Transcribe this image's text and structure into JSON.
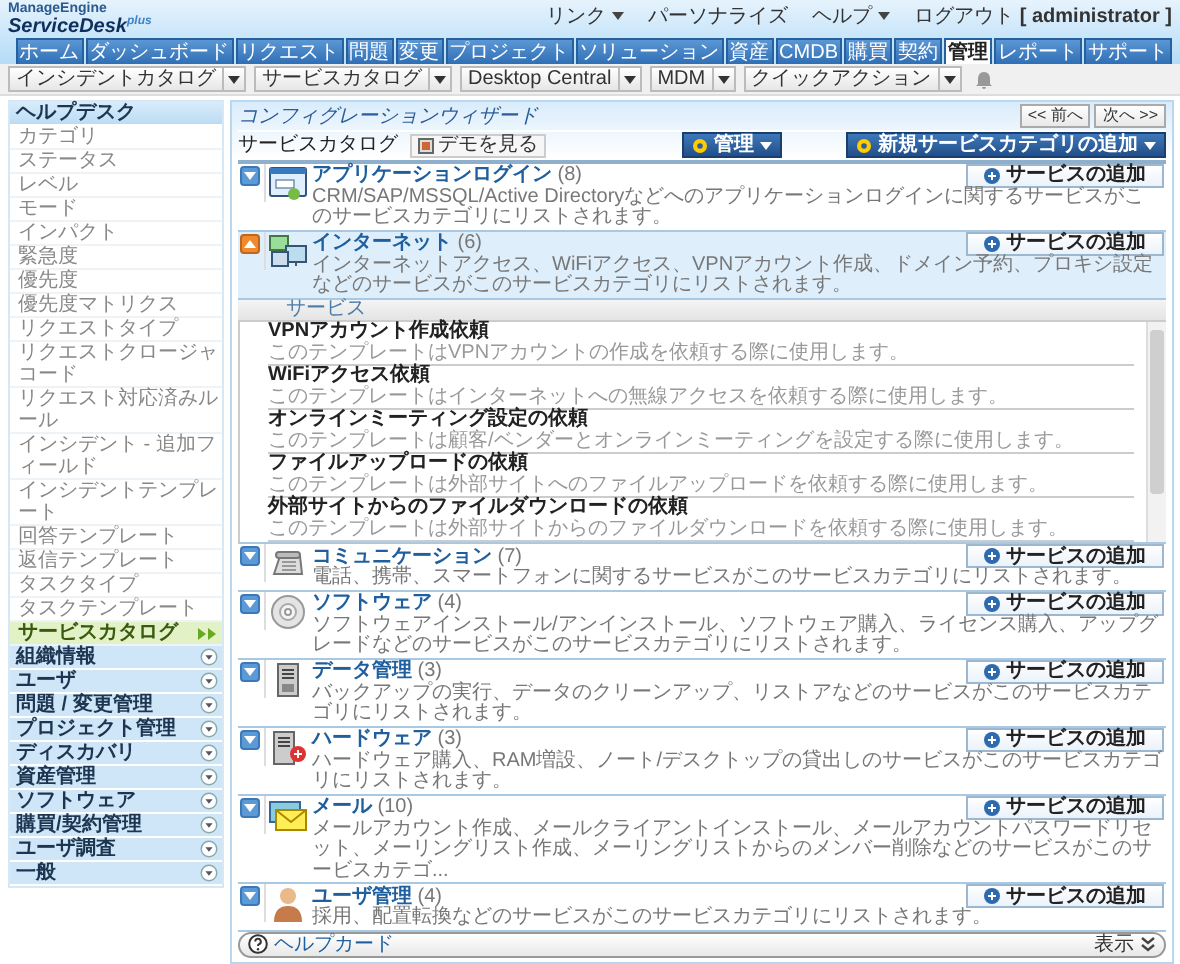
{
  "logo": {
    "brand": "ManageEngine",
    "product": "ServiceDesk",
    "edition": "plus"
  },
  "top_links": [
    {
      "label": "リンク",
      "has_menu": true
    },
    {
      "label": "パーソナライズ",
      "has_menu": false
    },
    {
      "label": "ヘルプ",
      "has_menu": true
    },
    {
      "label": "ログアウト **[ administrator ]**",
      "has_menu": false
    }
  ],
  "tabs": [
    {
      "label": "ホーム",
      "selected": false
    },
    {
      "label": "ダッシュボード",
      "selected": false
    },
    {
      "label": "リクエスト",
      "selected": false
    },
    {
      "label": "問題",
      "selected": false
    },
    {
      "label": "変更",
      "selected": false
    },
    {
      "label": "プロジェクト",
      "selected": false
    },
    {
      "label": "ソリューション",
      "selected": false
    },
    {
      "label": "資産",
      "selected": false
    },
    {
      "label": "CMDB",
      "selected": false
    },
    {
      "label": "購買",
      "selected": false
    },
    {
      "label": "契約",
      "selected": false
    },
    {
      "label": "管理",
      "selected": true
    },
    {
      "label": "レポート",
      "selected": false
    },
    {
      "label": "サポート",
      "selected": false
    }
  ],
  "toolbar": [
    "インシデントカタログ",
    "サービスカタログ",
    "Desktop Central",
    "MDM",
    "クイックアクション"
  ],
  "sidebar": {
    "sections": [
      {
        "label": "ヘルプデスク",
        "expanded": true,
        "children": [
          {
            "label": "カテゴリ",
            "selected": false
          },
          {
            "label": "ステータス",
            "selected": false
          },
          {
            "label": "レベル",
            "selected": false
          },
          {
            "label": "モード",
            "selected": false
          },
          {
            "label": "インパクト",
            "selected": false
          },
          {
            "label": "緊急度",
            "selected": false
          },
          {
            "label": "優先度",
            "selected": false
          },
          {
            "label": "優先度マトリクス",
            "selected": false
          },
          {
            "label": "リクエストタイプ",
            "selected": false
          },
          {
            "label": "リクエストクロージャコード",
            "selected": false
          },
          {
            "label": "リクエスト対応済みルール",
            "selected": false
          },
          {
            "label": "インシデント - 追加フィールド",
            "selected": false
          },
          {
            "label": "インシデントテンプレート",
            "selected": false
          },
          {
            "label": "回答テンプレート",
            "selected": false
          },
          {
            "label": "返信テンプレート",
            "selected": false
          },
          {
            "label": "タスクタイプ",
            "selected": false
          },
          {
            "label": "タスクテンプレート",
            "selected": false
          },
          {
            "label": "サービスカタログ",
            "selected": true
          }
        ]
      },
      {
        "label": "組織情報",
        "expanded": false
      },
      {
        "label": "ユーザ",
        "expanded": false
      },
      {
        "label": "問題 / 変更管理",
        "expanded": false
      },
      {
        "label": "プロジェクト管理",
        "expanded": false
      },
      {
        "label": "ディスカバリ",
        "expanded": false
      },
      {
        "label": "資産管理",
        "expanded": false
      },
      {
        "label": "ソフトウェア",
        "expanded": false
      },
      {
        "label": "購買/契約管理",
        "expanded": false
      },
      {
        "label": "ユーザ調査",
        "expanded": false
      },
      {
        "label": "一般",
        "expanded": false
      }
    ]
  },
  "wizard": {
    "title": "コンフィグレーションウィザード",
    "prev": "<< 前へ",
    "next": "次へ >>"
  },
  "catalog": {
    "title": "サービスカタログ",
    "demo": "デモを見る",
    "manage": "管理",
    "add_category": "新規サービスカテゴリの追加"
  },
  "categories": [
    {
      "title": "アプリケーションログイン",
      "count": "(8)",
      "description": "CRM/SAP/MSSQL/Active Directoryなどへのアプリケーションログインに関するサービスがこのサービスカテゴリにリストされます。",
      "button": "サービスの追加",
      "expanded": false
    },
    {
      "title": "インターネット",
      "count": "(6)",
      "description": "インターネットアクセス、WiFiアクセス、VPNアカウント作成、ドメイン予約、プロキシ設定などのサービスがこのサービスカテゴリにリストされます。",
      "button": "サービスの追加",
      "expanded": true,
      "services_heading": "サービス",
      "services": [
        {
          "title": "VPNアカウント作成依頼",
          "description": "このテンプレートはVPNアカウントの作成を依頼する際に使用します。"
        },
        {
          "title": "WiFiアクセス依頼",
          "description": "このテンプレートはインターネットへの無線アクセスを依頼する際に使用します。"
        },
        {
          "title": "オンラインミーティング設定の依頼",
          "description": "このテンプレートは顧客/ベンダーとオンラインミーティングを設定する際に使用します。"
        },
        {
          "title": "ファイルアップロードの依頼",
          "description": "このテンプレートは外部サイトへのファイルアップロードを依頼する際に使用します。"
        },
        {
          "title": "外部サイトからのファイルダウンロードの依頼",
          "description": "このテンプレートは外部サイトからのファイルダウンロードを依頼する際に使用します。"
        }
      ]
    },
    {
      "title": "コミュニケーション",
      "count": "(7)",
      "description": "電話、携帯、スマートフォンに関するサービスがこのサービスカテゴリにリストされます。",
      "button": "サービスの追加",
      "expanded": false
    },
    {
      "title": "ソフトウェア",
      "count": "(4)",
      "description": "ソフトウェアインストール/アンインストール、ソフトウェア購入、ライセンス購入、アップグレードなどのサービスがこのサービスカテゴリにリストされます。",
      "button": "サービスの追加",
      "expanded": false
    },
    {
      "title": "データ管理",
      "count": "(3)",
      "description": "バックアップの実行、データのクリーンアップ、リストアなどのサービスがこのサービスカテゴリにリストされます。",
      "button": "サービスの追加",
      "expanded": false
    },
    {
      "title": "ハードウェア",
      "count": "(3)",
      "description": "ハードウェア購入、RAM増設、ノート/デスクトップの貸出しのサービスがこのサービスカテゴリにリストされます。",
      "button": "サービスの追加",
      "expanded": false
    },
    {
      "title": "メール",
      "count": "(10)",
      "description": "メールアカウント作成、メールクライアントインストール、メールアカウントパスワードリセット、メーリングリスト作成、メーリングリストからのメンバー削除などのサービスがこのサービスカテゴ...",
      "button": "サービスの追加",
      "expanded": false
    },
    {
      "title": "ユーザ管理",
      "count": "(4)",
      "description": "採用、配置転換などのサービスがこのサービスカテゴリにリストされます。",
      "button": "サービスの追加",
      "expanded": false
    }
  ],
  "help_card": {
    "title": "ヘルプカード",
    "toggle": "表示"
  }
}
